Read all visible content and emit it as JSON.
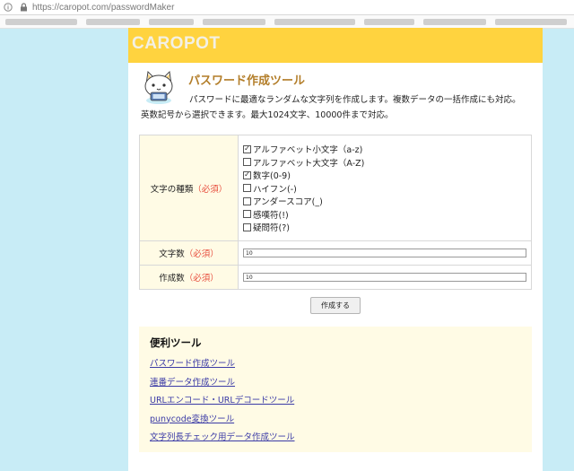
{
  "browser": {
    "url": "https://caropot.com/passwordMaker",
    "info_icon": "info-icon",
    "lock_icon": "lock-icon"
  },
  "site": {
    "logo": "CAROPOT",
    "mascot_icon": "cat-mascot-icon"
  },
  "main": {
    "title": "パスワード作成ツール",
    "desc_line1": "パスワードに最適なランダムな文字列を作成します。複数データの一括作成にも対応。",
    "desc_line2": "英数記号から選択できます。最大1024文字、10000件まで対応。"
  },
  "form": {
    "required_mark": "（必須）",
    "char_types": {
      "label": "文字の種類",
      "options": [
        {
          "label": "アルファベット小文字（a-z)",
          "checked": true
        },
        {
          "label": "アルファベット大文字（A-Z)",
          "checked": false
        },
        {
          "label": "数字(0-9)",
          "checked": true
        },
        {
          "label": "ハイフン(-)",
          "checked": false
        },
        {
          "label": "アンダースコア(_)",
          "checked": false
        },
        {
          "label": "感嘆符(!)",
          "checked": false
        },
        {
          "label": "疑問符(?)",
          "checked": false
        }
      ]
    },
    "length": {
      "label": "文字数",
      "value": "10"
    },
    "count": {
      "label": "作成数",
      "value": "10"
    },
    "submit_label": "作成する"
  },
  "tools": {
    "title": "便利ツール",
    "links": [
      "パスワード作成ツール",
      "連番データ作成ツール",
      "URLエンコード・URLデコードツール",
      "punycode変換ツール",
      "文字列長チェック用データ作成ツール"
    ]
  },
  "colors": {
    "background": "#c8ecf6",
    "header": "#ffd33f",
    "title": "#b37e2a",
    "required": "#e74c3c",
    "label_bg": "#fffbe5",
    "link": "#3a3aa6"
  }
}
